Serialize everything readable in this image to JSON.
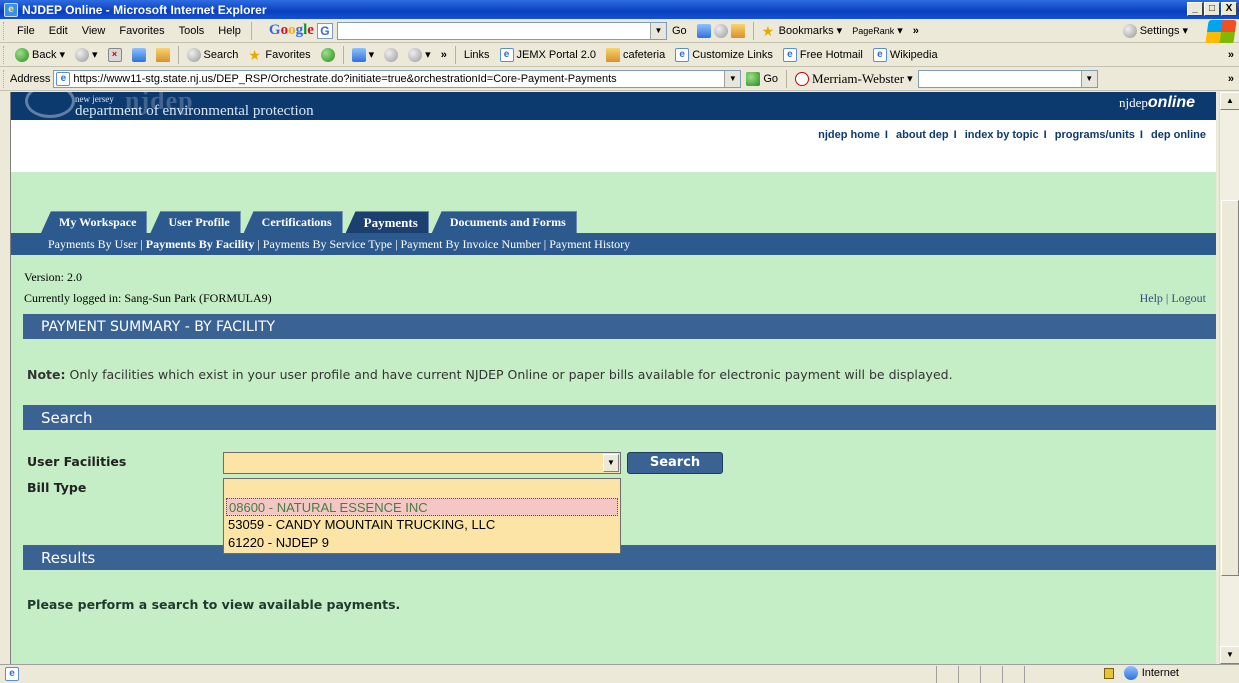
{
  "window": {
    "title": "NJDEP Online - Microsoft Internet Explorer"
  },
  "menu": {
    "items": [
      "File",
      "Edit",
      "View",
      "Favorites",
      "Tools",
      "Help"
    ]
  },
  "google_toolbar": {
    "logo": "Google",
    "go": "Go",
    "bookmarks": "Bookmarks",
    "pagerank": "PageRank",
    "more": "»",
    "settings": "Settings"
  },
  "standard_toolbar": {
    "back": "Back",
    "search": "Search",
    "favorites": "Favorites",
    "more": "»"
  },
  "links": {
    "label": "Links",
    "items": [
      "JEMX Portal 2.0",
      "cafeteria",
      "Customize Links",
      "Free Hotmail",
      "Wikipedia"
    ],
    "more": "»"
  },
  "address": {
    "label": "Address",
    "url": "https://www11-stg.state.nj.us/DEP_RSP/Orchestrate.do?initiate=true&orchestrationId=Core-Payment-Payments",
    "go": "Go",
    "dictionary": "Merriam-Webster",
    "more": "»"
  },
  "site": {
    "njdep_logo_text": "njdep",
    "state": "new jersey",
    "department": "department of environmental protection",
    "brand_prefix": "njdep",
    "brand_suffix": "online",
    "top_links": [
      "njdep home",
      "about dep",
      "index by topic",
      "programs/units",
      "dep online"
    ]
  },
  "tabs": [
    "My Workspace",
    "User Profile",
    "Certifications",
    "Payments",
    "Documents and Forms"
  ],
  "active_tab": "Payments",
  "subnav": [
    "Payments By User",
    "Payments By Facility",
    "Payments By Service Type",
    "Payment By Invoice Number",
    "Payment History"
  ],
  "version": "Version: 2.0",
  "logged_in": "Currently logged in: Sang-Sun Park (FORMULA9)",
  "help": "Help",
  "logout": "Logout",
  "page_title": "PAYMENT SUMMARY - BY FACILITY",
  "note_label": "Note:",
  "note_text": "Only facilities which exist in your user profile and have current NJDEP Online or paper bills available for electronic payment will be displayed.",
  "search_section": "Search",
  "user_facilities_label": "User Facilities",
  "bill_type_label": "Bill Type",
  "search_button": "Search",
  "facility_options": [
    "08600 - NATURAL ESSENCE INC",
    "53059 - CANDY MOUNTAIN TRUCKING, LLC",
    "61220 - NJDEP 9"
  ],
  "results_section": "Results",
  "results_prompt": "Please perform a search to view available payments.",
  "status": {
    "zone": "Internet"
  }
}
